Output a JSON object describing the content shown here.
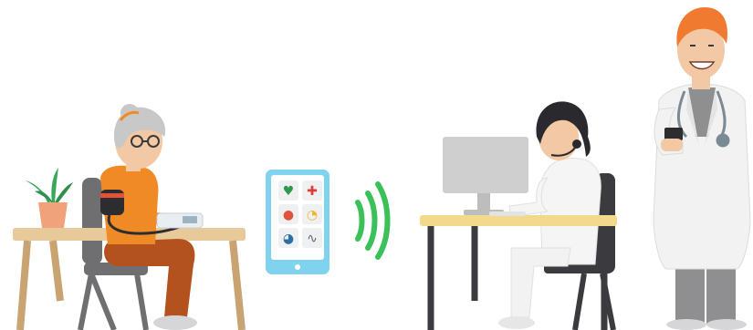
{
  "scene": {
    "description_labels": [],
    "colors": {
      "background": "#ffffff",
      "table_top": "#e8c99a",
      "table_leg": "#c9a472",
      "chair": "#6f6f72",
      "patient_shirt": "#f08a24",
      "patient_pants": "#b4521f",
      "patient_hair": "#c8c8c8",
      "skin": "#f3c9a5",
      "plant": "#3aa65a",
      "pot": "#f0a37b",
      "tablet_frame": "#7fd3ee",
      "tablet_screen": "#ffffff",
      "signal": "#3cc05a",
      "monitor": "#cfcfcf",
      "desk_top": "#f2d98c",
      "desk_leg": "#3b3b3f",
      "nurse_coat": "#f5f5f5",
      "nurse_hair": "#2a2a2e",
      "doctor_hair": "#f07a2f",
      "doctor_coat": "#f2f2f2",
      "doctor_pants": "#8f8f92",
      "stethoscope": "#7b8b95",
      "cuff": "#2d2d30",
      "bp_monitor": "#e9eef2"
    },
    "tablet_icons": [
      {
        "name": "heart-icon",
        "glyph": "♥",
        "color": "#2e9a4a"
      },
      {
        "name": "plus-icon",
        "glyph": "✚",
        "color": "#e03a3a"
      },
      {
        "name": "apple-icon",
        "glyph": "●",
        "color": "#e0533a"
      },
      {
        "name": "clock-icon",
        "glyph": "◔",
        "color": "#f2b631"
      },
      {
        "name": "pie-icon",
        "glyph": "◕",
        "color": "#2d6fa3"
      },
      {
        "name": "pulse-icon",
        "glyph": "∿",
        "color": "#5a6a7a"
      }
    ]
  }
}
